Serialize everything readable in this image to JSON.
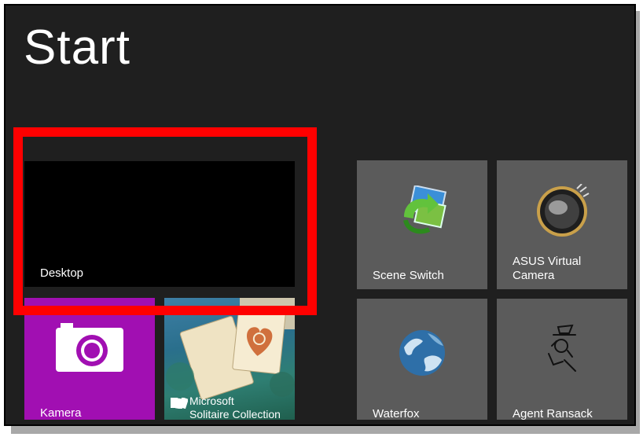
{
  "screen": {
    "title": "Start"
  },
  "tiles": {
    "desktop": {
      "label": "Desktop",
      "color": "#000000"
    },
    "kamera": {
      "label": "Kamera",
      "color": "#a10fb2",
      "icon": "camera-icon"
    },
    "solitaire": {
      "label_line1": "Microsoft",
      "label_line2": "Solitaire Collection",
      "icon": "solitaire-cards-icon"
    },
    "scene_switch": {
      "label": "Scene Switch",
      "icon": "scene-switch-icon"
    },
    "asus_camera": {
      "label_line1": "ASUS Virtual",
      "label_line2": "Camera",
      "icon": "webcam-icon"
    },
    "waterfox": {
      "label": "Waterfox",
      "icon": "waterfox-globe-icon"
    },
    "agent_ransack": {
      "label": "Agent Ransack",
      "icon": "agent-ransack-icon"
    }
  },
  "annotation": {
    "highlight_color": "#ff0000"
  }
}
